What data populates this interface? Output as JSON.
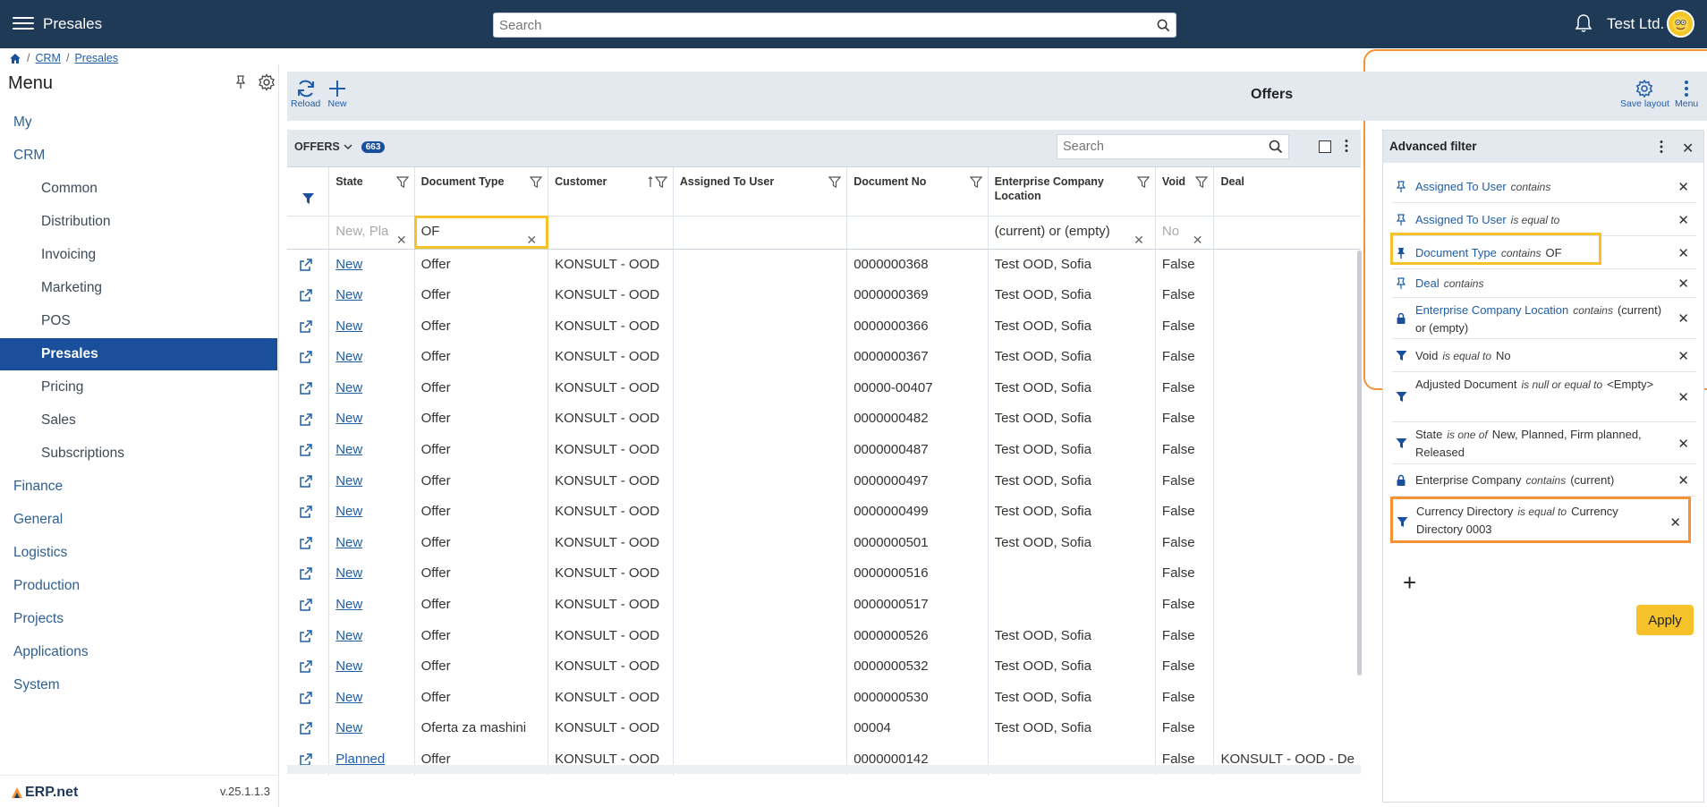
{
  "topbar": {
    "app_title": "Presales",
    "search_placeholder": "Search",
    "company": "Test Ltd."
  },
  "breadcrumb": {
    "items": [
      "CRM",
      "Presales"
    ]
  },
  "menu": {
    "title": "Menu",
    "items": [
      {
        "label": "My",
        "level": 0
      },
      {
        "label": "CRM",
        "level": 0
      },
      {
        "label": "Common",
        "level": 1
      },
      {
        "label": "Distribution",
        "level": 1
      },
      {
        "label": "Invoicing",
        "level": 1
      },
      {
        "label": "Marketing",
        "level": 1
      },
      {
        "label": "POS",
        "level": 1
      },
      {
        "label": "Presales",
        "level": 1,
        "active": true
      },
      {
        "label": "Pricing",
        "level": 1
      },
      {
        "label": "Sales",
        "level": 1
      },
      {
        "label": "Subscriptions",
        "level": 1
      },
      {
        "label": "Finance",
        "level": 0
      },
      {
        "label": "General",
        "level": 0
      },
      {
        "label": "Logistics",
        "level": 0
      },
      {
        "label": "Production",
        "level": 0
      },
      {
        "label": "Projects",
        "level": 0
      },
      {
        "label": "Applications",
        "level": 0
      },
      {
        "label": "System",
        "level": 0
      }
    ],
    "logo": "ERP.net",
    "version": "v.25.1.1.3"
  },
  "toolbar": {
    "reload_label": "Reload",
    "new_label": "New",
    "title": "Offers",
    "save_layout_label": "Save layout",
    "menu_label": "Menu"
  },
  "grid": {
    "label": "OFFERS",
    "count": "663",
    "search_placeholder": "Search",
    "columns": [
      "State",
      "Document Type",
      "Customer",
      "Assigned To User",
      "Document No",
      "Enterprise Company Location",
      "Void",
      "Deal"
    ],
    "filters": {
      "state": "New, Pla",
      "document_type": "OF",
      "location": "(current) or (empty)",
      "void": "No"
    },
    "rows": [
      [
        "New",
        "Offer",
        "KONSULT - OOD",
        "",
        "0000000368",
        "Test OOD, Sofia",
        "False",
        ""
      ],
      [
        "New",
        "Offer",
        "KONSULT - OOD",
        "",
        "0000000369",
        "Test OOD, Sofia",
        "False",
        ""
      ],
      [
        "New",
        "Offer",
        "KONSULT - OOD",
        "",
        "0000000366",
        "Test OOD, Sofia",
        "False",
        ""
      ],
      [
        "New",
        "Offer",
        "KONSULT - OOD",
        "",
        "0000000367",
        "Test OOD, Sofia",
        "False",
        ""
      ],
      [
        "New",
        "Offer",
        "KONSULT - OOD",
        "",
        "00000-00407",
        "Test OOD, Sofia",
        "False",
        ""
      ],
      [
        "New",
        "Offer",
        "KONSULT - OOD",
        "",
        "0000000482",
        "Test OOD, Sofia",
        "False",
        ""
      ],
      [
        "New",
        "Offer",
        "KONSULT - OOD",
        "",
        "0000000487",
        "Test OOD, Sofia",
        "False",
        ""
      ],
      [
        "New",
        "Offer",
        "KONSULT - OOD",
        "",
        "0000000497",
        "Test OOD, Sofia",
        "False",
        ""
      ],
      [
        "New",
        "Offer",
        "KONSULT - OOD",
        "",
        "0000000499",
        "Test OOD, Sofia",
        "False",
        ""
      ],
      [
        "New",
        "Offer",
        "KONSULT - OOD",
        "",
        "0000000501",
        "Test OOD, Sofia",
        "False",
        ""
      ],
      [
        "New",
        "Offer",
        "KONSULT - OOD",
        "",
        "0000000516",
        "",
        "False",
        ""
      ],
      [
        "New",
        "Offer",
        "KONSULT - OOD",
        "",
        "0000000517",
        "",
        "False",
        ""
      ],
      [
        "New",
        "Offer",
        "KONSULT - OOD",
        "",
        "0000000526",
        "Test OOD, Sofia",
        "False",
        ""
      ],
      [
        "New",
        "Offer",
        "KONSULT - OOD",
        "",
        "0000000532",
        "Test OOD, Sofia",
        "False",
        ""
      ],
      [
        "New",
        "Offer",
        "KONSULT - OOD",
        "",
        "0000000530",
        "Test OOD, Sofia",
        "False",
        ""
      ],
      [
        "New",
        "Oferta za mashini",
        "KONSULT - OOD",
        "",
        "00004",
        "Test OOD, Sofia",
        "False",
        ""
      ],
      [
        "Planned",
        "Offer",
        "KONSULT - OOD",
        "",
        "0000000142",
        "",
        "False",
        "KONSULT - OOD - De"
      ]
    ]
  },
  "advanced_filter": {
    "title": "Advanced filter",
    "apply_label": "Apply",
    "items": [
      {
        "icon": "pin-outline-icon",
        "field": "Assigned To User",
        "op": "contains",
        "value": "",
        "link": true
      },
      {
        "icon": "pin-outline-icon",
        "field": "Assigned To User",
        "op": "is equal to",
        "value": "",
        "link": true
      },
      {
        "icon": "pin-filled-icon",
        "field": "Document Type",
        "op": "contains",
        "value": "OF",
        "link": true,
        "highlight": "yellow"
      },
      {
        "icon": "pin-outline-icon",
        "field": "Deal",
        "op": "contains",
        "value": "",
        "link": true
      },
      {
        "icon": "lock-icon",
        "field": "Enterprise Company Location",
        "op": "contains",
        "value": "(current) or (empty)",
        "link": true
      },
      {
        "icon": "funnel-icon",
        "field": "Void",
        "op": "is equal to",
        "value": "No",
        "link": false
      },
      {
        "icon": "funnel-icon",
        "field": "Adjusted Document",
        "op": "is null or equal to",
        "value": "<Empty>",
        "link": false
      },
      {
        "icon": "funnel-icon",
        "field": "State",
        "op": "is one of",
        "value": "New, Planned, Firm planned, Released",
        "link": false
      },
      {
        "icon": "lock-icon",
        "field": "Enterprise Company",
        "op": "contains",
        "value": "(current)",
        "link": false
      },
      {
        "icon": "funnel-icon",
        "field": "Currency Directory",
        "op": "is equal to",
        "value": "Currency Directory 0003",
        "link": false,
        "highlight": "orange"
      }
    ]
  },
  "colors": {
    "topbar": "#1e3a57",
    "accent": "#1a4f9c",
    "link": "#1f5ea8",
    "highlight_yellow": "#f5c22a",
    "highlight_orange": "#f39336"
  }
}
